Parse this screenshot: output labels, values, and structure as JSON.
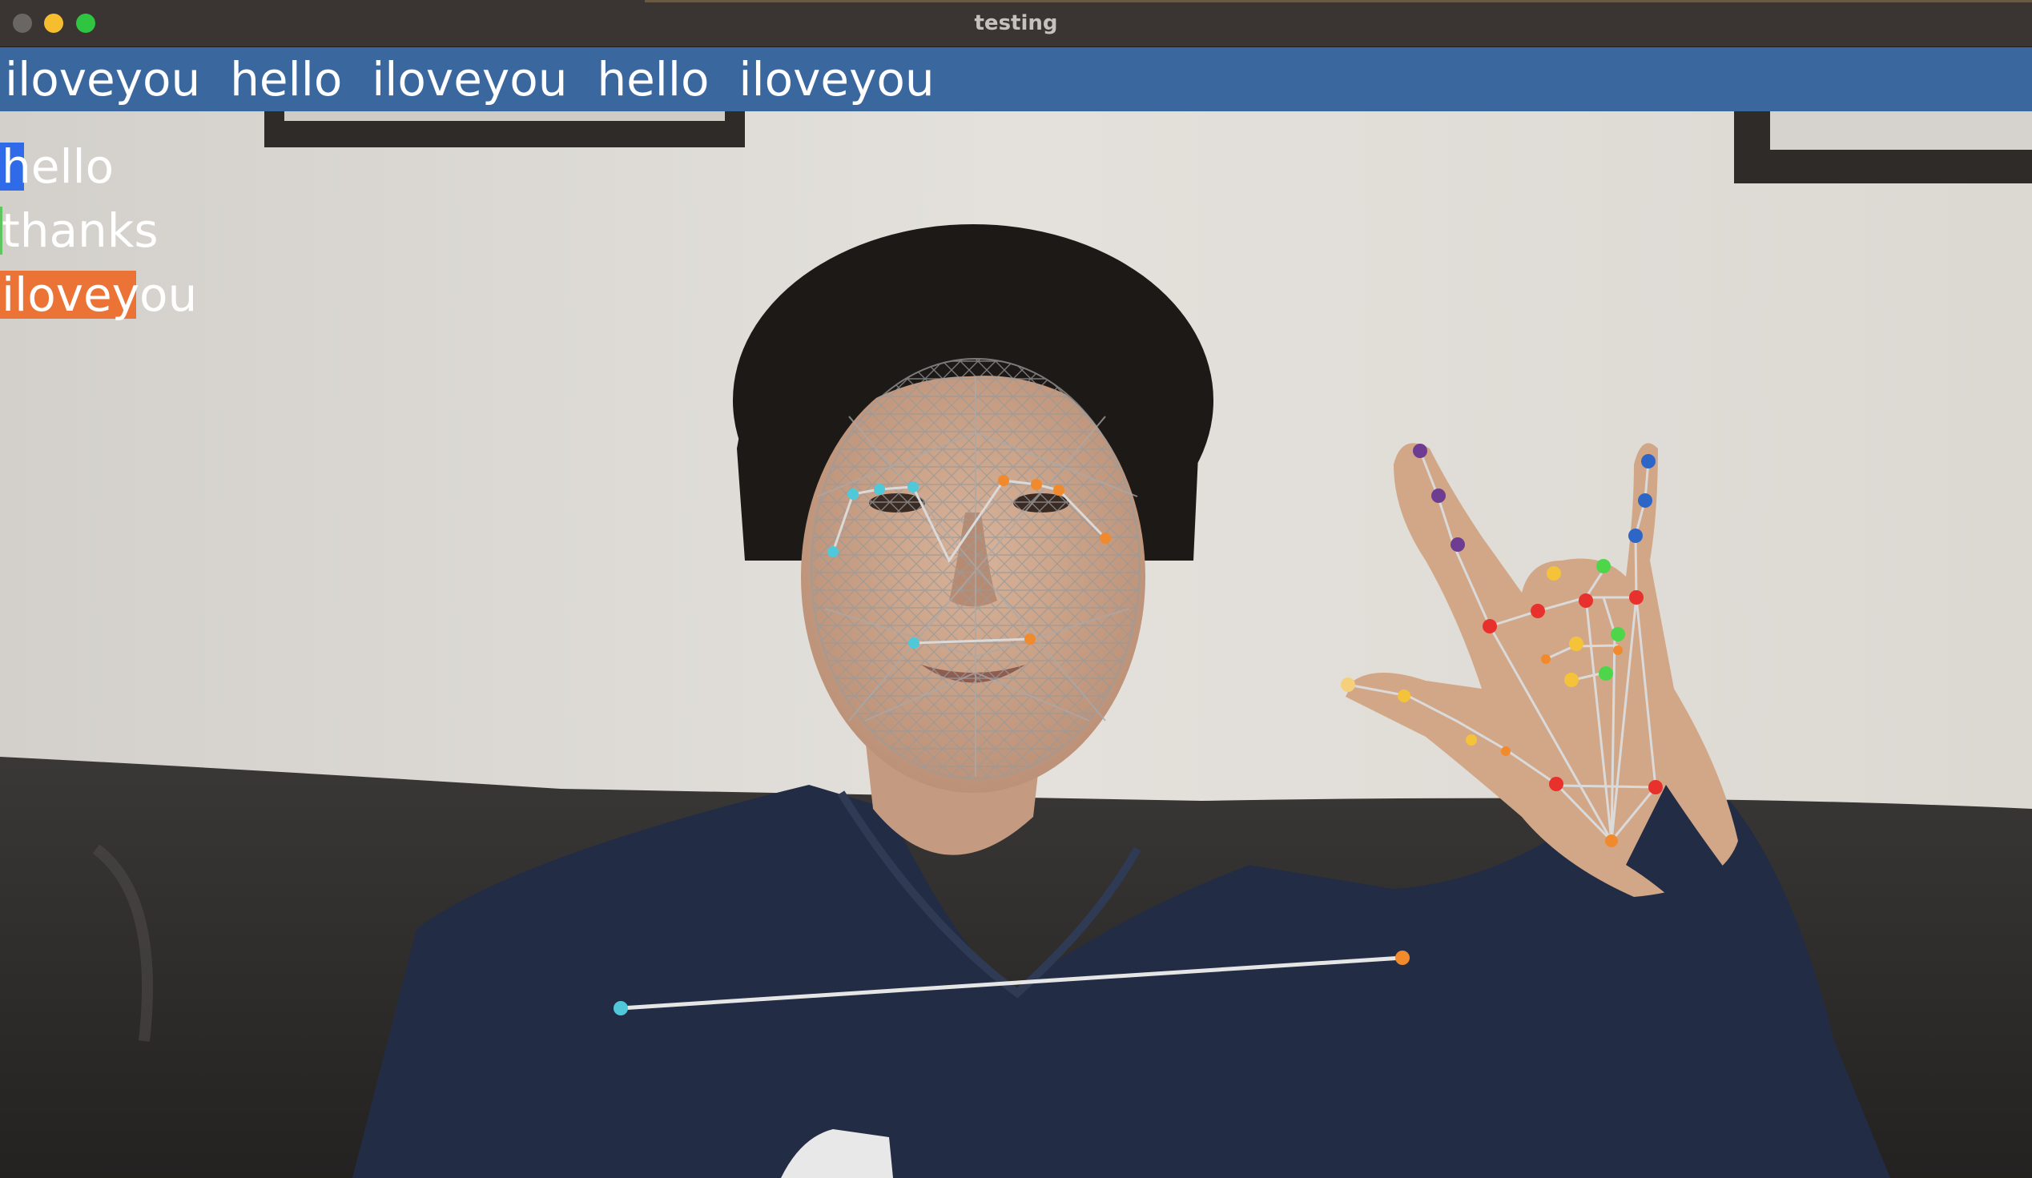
{
  "window": {
    "title": "testing",
    "controls": {
      "close_color": "#6a6664",
      "minimize_color": "#f6be2e",
      "maximize_color": "#2fc541"
    }
  },
  "sentence": {
    "text": "iloveyou  hello  iloveyou  hello  iloveyou",
    "background_color": "#3b679f"
  },
  "probabilities": [
    {
      "label": "hello",
      "color": "#2f6be8",
      "probability": 0.01
    },
    {
      "label": "thanks",
      "color": "#5fc65f",
      "probability": 0.0
    },
    {
      "label": "iloveyou",
      "color": "#ea7335",
      "probability": 0.07
    }
  ],
  "overlay": {
    "face_mesh": "face-mesh-icon",
    "pose_landmarks": "pose-landmarks-icon",
    "hand_landmarks": "hand-landmarks-icon"
  }
}
